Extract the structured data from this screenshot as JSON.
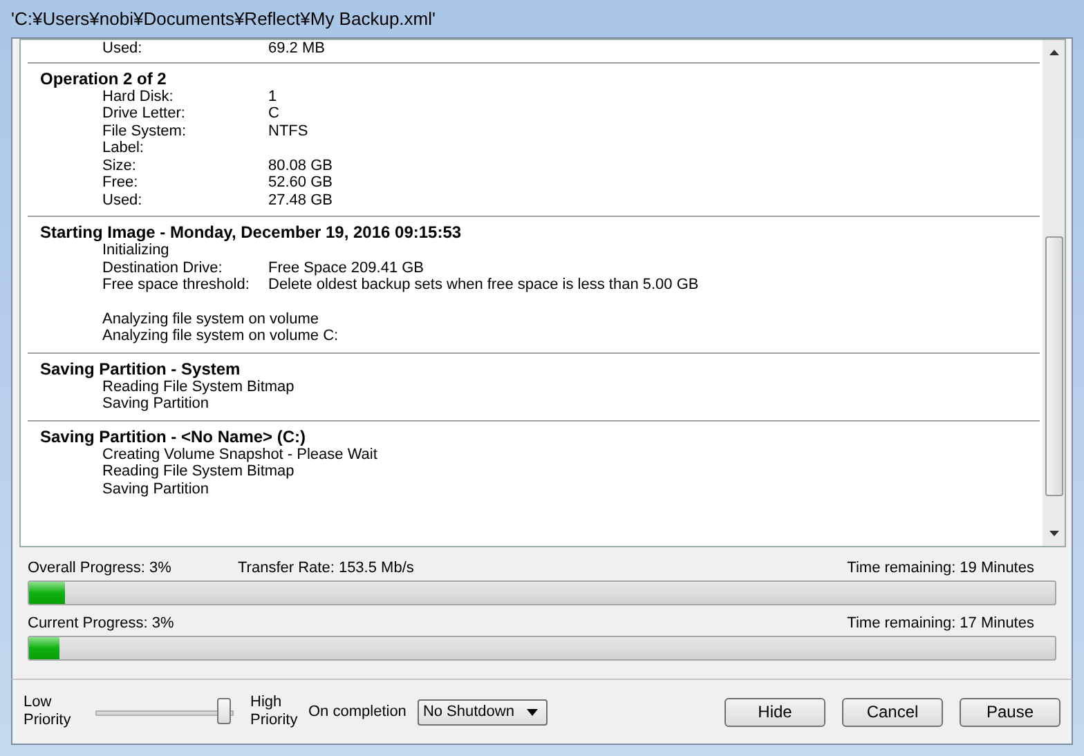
{
  "window": {
    "title": "'C:¥Users¥nobi¥Documents¥Reflect¥My Backup.xml'"
  },
  "log": [
    {
      "lines": [
        {
          "kind": "pair",
          "label": "Used:",
          "value": "69.2 MB"
        }
      ]
    },
    {
      "title": "Operation 2 of 2",
      "lines": [
        {
          "kind": "pair",
          "label": "Hard Disk:",
          "value": "1"
        },
        {
          "kind": "pair",
          "label": "Drive Letter:",
          "value": "C"
        },
        {
          "kind": "pair",
          "label": "File System:",
          "value": "NTFS"
        },
        {
          "kind": "pair",
          "label": "Label:"
        },
        {
          "kind": "pair",
          "label": "Size:",
          "value": "80.08 GB"
        },
        {
          "kind": "pair",
          "label": "Free:",
          "value": "52.60 GB"
        },
        {
          "kind": "pair",
          "label": "Used:",
          "value": "27.48 GB"
        }
      ]
    },
    {
      "title": "Starting Image - Monday, December 19, 2016 09:15:53",
      "lines": [
        {
          "kind": "text",
          "text": "Initializing"
        },
        {
          "kind": "pair",
          "label": "Destination Drive:",
          "value": "Free Space 209.41 GB"
        },
        {
          "kind": "pair",
          "label": "Free space threshold:",
          "value": "Delete oldest backup sets when free space is less than 5.00 GB"
        },
        {
          "kind": "blank"
        },
        {
          "kind": "text",
          "text": "Analyzing file system on volume"
        },
        {
          "kind": "text",
          "text": "Analyzing file system on volume C:"
        }
      ]
    },
    {
      "title": "Saving Partition - System",
      "lines": [
        {
          "kind": "text",
          "text": "Reading File System Bitmap"
        },
        {
          "kind": "text",
          "text": "Saving Partition"
        }
      ]
    },
    {
      "title": "Saving Partition - <No Name> (C:)",
      "lines": [
        {
          "kind": "text",
          "text": "Creating Volume Snapshot - Please Wait"
        },
        {
          "kind": "text",
          "text": "Reading File System Bitmap"
        },
        {
          "kind": "text",
          "text": "Saving Partition"
        }
      ]
    }
  ],
  "progress": [
    {
      "label": "Overall Progress:  3%",
      "rate": "Transfer Rate: 153.5 Mb/s",
      "remaining": "Time remaining: 19 Minutes",
      "level": 0.035
    },
    {
      "label": "Current Progress:  3%",
      "remaining": "Time remaining: 17 Minutes",
      "level": 0.03
    }
  ],
  "priority": {
    "low": "Low Priority",
    "high": "High Priority",
    "level": 1
  },
  "completion": {
    "label": "On completion",
    "value": "No Shutdown"
  },
  "buttons": [
    "Hide",
    "Cancel",
    "Pause"
  ]
}
